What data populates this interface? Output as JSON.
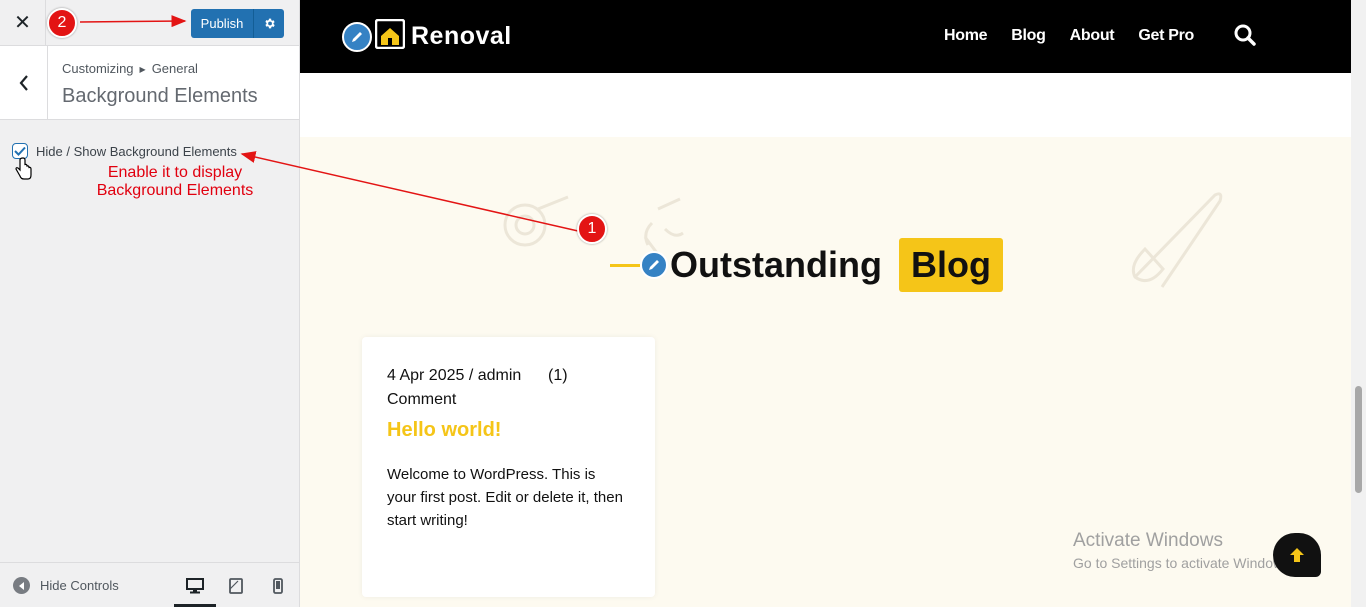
{
  "sidebar": {
    "close_glyph": "✕",
    "publish_label": "Publish",
    "breadcrumb": {
      "root": "Customizing",
      "parent": "General"
    },
    "section_title": "Background Elements",
    "toggle": {
      "label": "Hide / Show Background Elements",
      "checked": true
    },
    "annotation": "Enable it to display Background Elements",
    "footer": {
      "hide_controls_label": "Hide Controls",
      "active_device": "desktop"
    }
  },
  "badges": {
    "one": "1",
    "two": "2"
  },
  "site": {
    "logo_text": "Renoval",
    "nav": [
      "Home",
      "Blog",
      "About",
      "Get Pro"
    ],
    "heading": {
      "text": "Outstanding",
      "highlight": "Blog"
    },
    "post": {
      "meta": "4 Apr 2025 / admin",
      "comments_count": "(1)",
      "comments_word": "Comment",
      "title": "Hello world!",
      "excerpt": "Welcome to WordPress. This is your first post. Edit or delete it, then start writing!"
    }
  },
  "watermark": {
    "title": "Activate Windows",
    "subtitle": "Go to Settings to activate Windows."
  },
  "colors": {
    "publish_blue": "#2271b1",
    "accent_yellow": "#f5c518",
    "annotation_red": "#e1000f",
    "header_black": "#000000",
    "cream_bg": "#fdfaf0"
  }
}
